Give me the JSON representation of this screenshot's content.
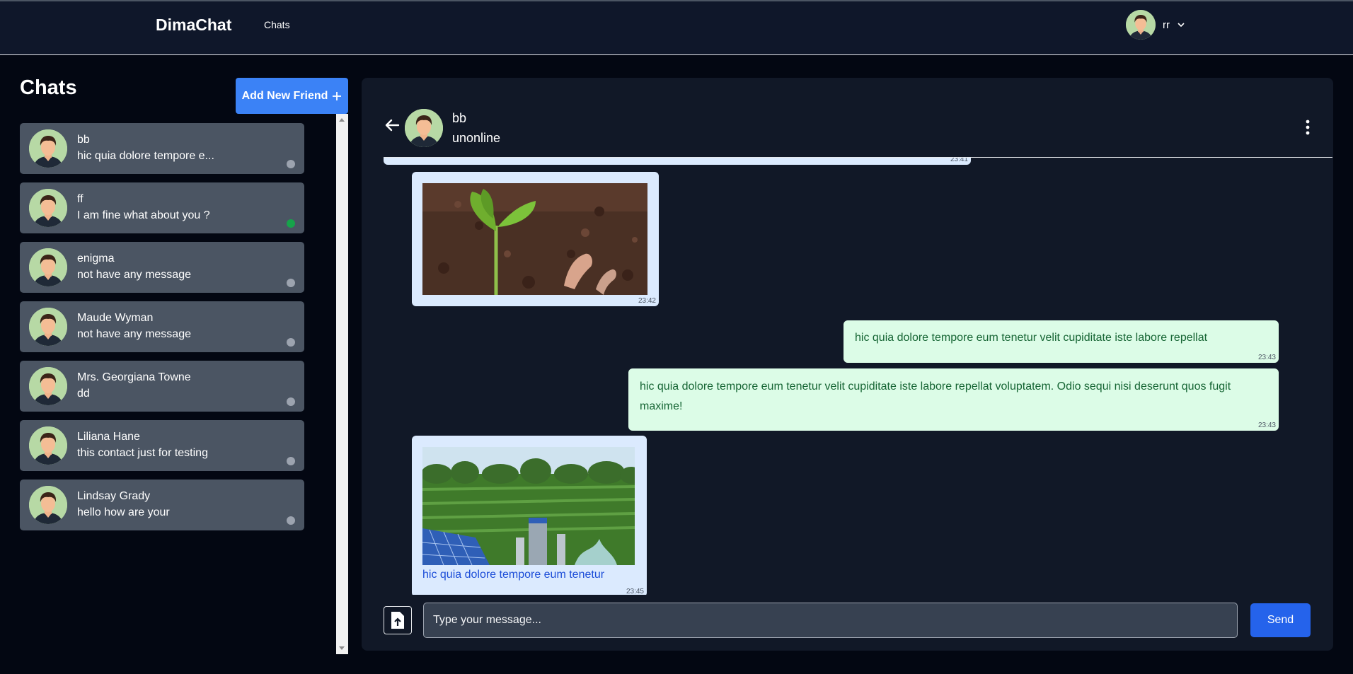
{
  "nav": {
    "brand": "DimaChat",
    "links": [
      "Chats"
    ],
    "user_name": "rr"
  },
  "sidebar": {
    "title": "Chats",
    "add_friend_label": "Add New Friend",
    "contacts": [
      {
        "name": "bb",
        "last_message": "hic quia dolore tempore e...",
        "online": false
      },
      {
        "name": "ff",
        "last_message": "I am fine what about you ?",
        "online": true
      },
      {
        "name": "enigma",
        "last_message": "not have any message",
        "online": false
      },
      {
        "name": "Maude Wyman",
        "last_message": "not have any message",
        "online": false
      },
      {
        "name": "Mrs. Georgiana Towne",
        "last_message": "dd",
        "online": false
      },
      {
        "name": "Liliana Hane",
        "last_message": "this contact just for testing",
        "online": false
      },
      {
        "name": "Lindsay Grady",
        "last_message": "hello how are your",
        "online": false
      }
    ]
  },
  "chat": {
    "peer_name": "bb",
    "peer_status": "unonline",
    "messages": [
      {
        "direction": "received",
        "type": "text",
        "time": "23:41"
      },
      {
        "direction": "received",
        "type": "image",
        "image": "plant-seedling-photo",
        "time": "23:42"
      },
      {
        "direction": "sent",
        "type": "text",
        "text": "hic quia dolore tempore eum tenetur velit cupiditate iste labore repellat",
        "time": "23:43"
      },
      {
        "direction": "sent",
        "type": "text",
        "text": "hic quia dolore tempore eum tenetur velit cupiditate iste labore repellat voluptatem. Odio sequi nisi deserunt quos fugit maxime!",
        "time": "23:43"
      },
      {
        "direction": "received",
        "type": "image",
        "image": "solar-farm-photo",
        "caption": "hic quia dolore tempore eum tenetur",
        "time": "23:45"
      }
    ]
  },
  "composer": {
    "placeholder": "Type your message...",
    "send_label": "Send"
  },
  "colors": {
    "accent": "#3b82f6",
    "send": "#2563eb",
    "sent_bubble": "#dcfce7",
    "received_bubble": "#dbeafe",
    "online": "#16a34a",
    "offline": "#9ca3af"
  }
}
